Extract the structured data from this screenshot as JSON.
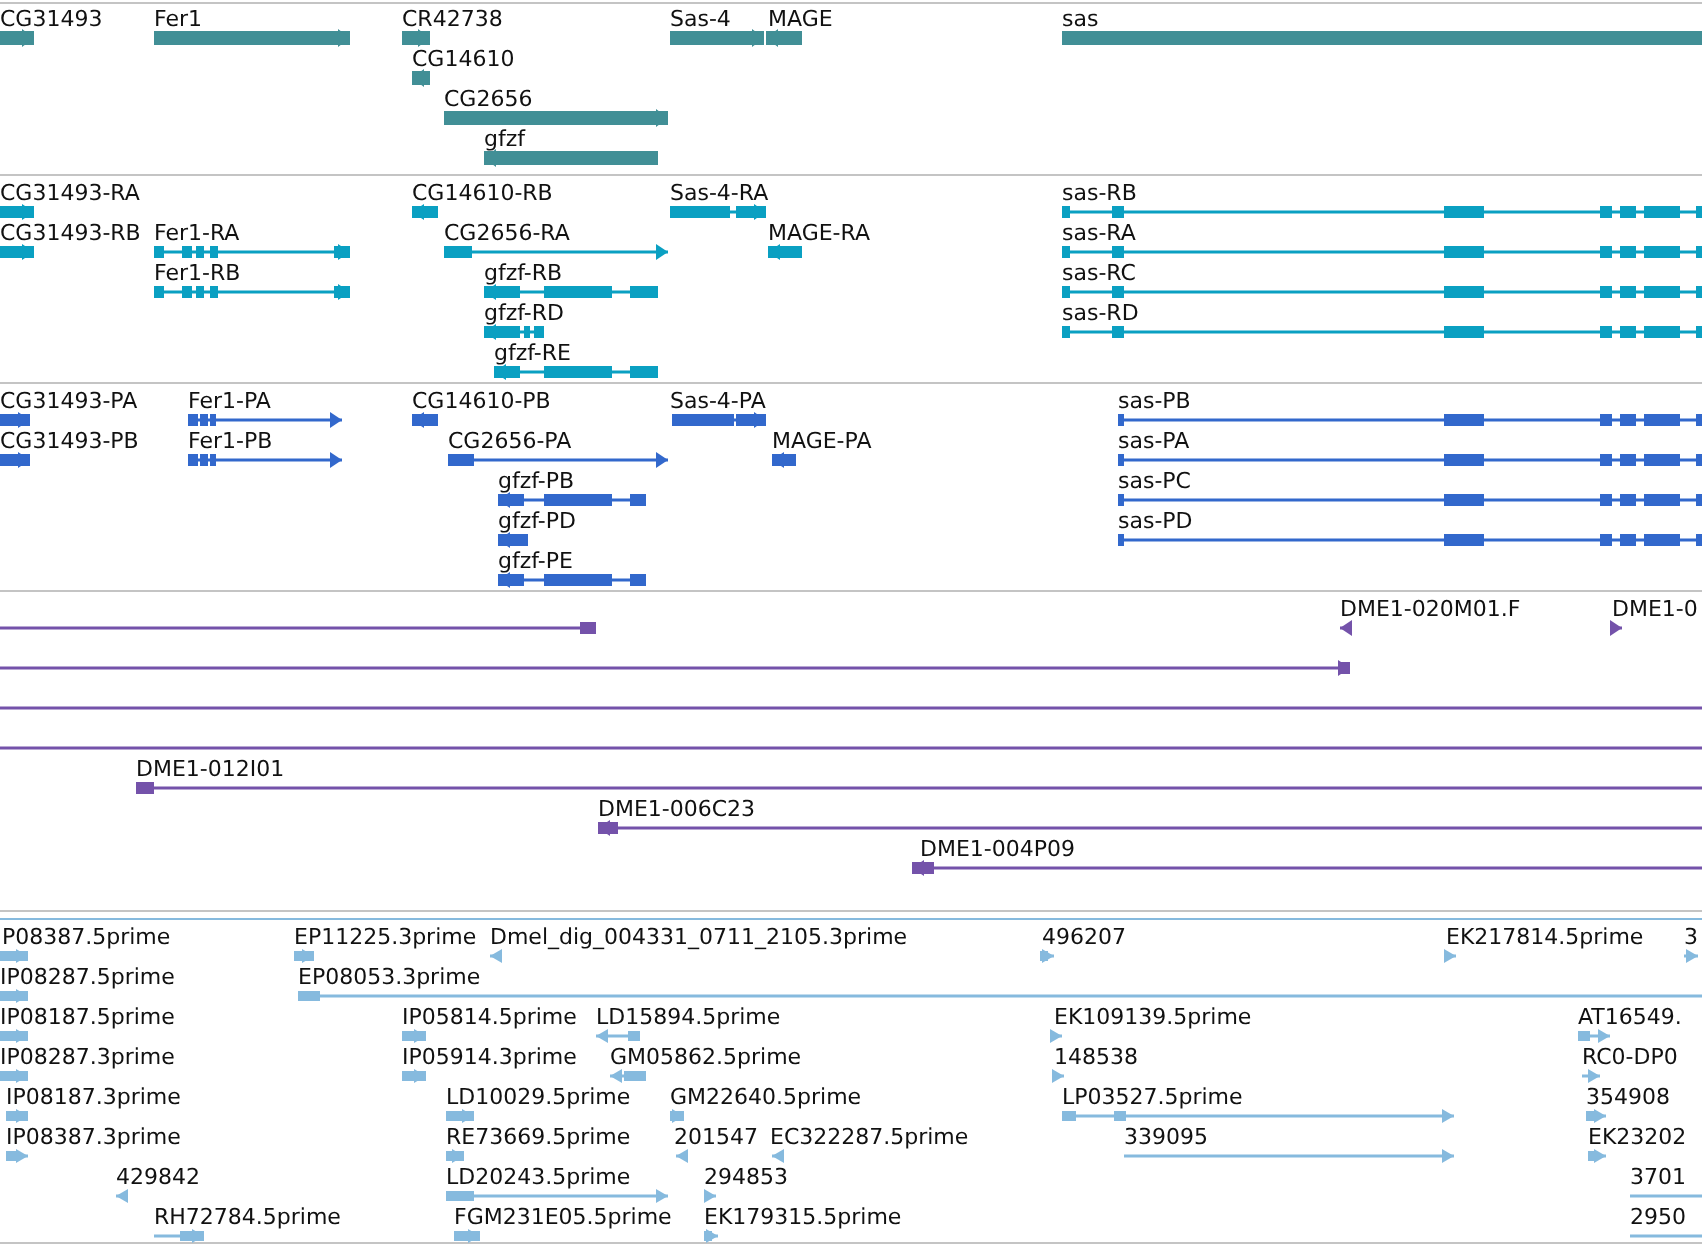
{
  "tracks": [
    {
      "kind": "gene",
      "features": [
        {
          "label": "CG31493",
          "reverse": false
        },
        {
          "label": "Fer1",
          "reverse": false
        },
        {
          "label": "CR42738",
          "reverse": false
        },
        {
          "label": "Sas-4",
          "reverse": false
        },
        {
          "label": "MAGE",
          "reverse": true
        },
        {
          "label": "sas",
          "clipped": true
        },
        {
          "label": "CG14610",
          "reverse": true
        },
        {
          "label": "CG2656",
          "reverse": false
        },
        {
          "label": "gfzf",
          "reverse": true
        }
      ]
    },
    {
      "kind": "transcript",
      "features": [
        {
          "label": "CG31493-RA",
          "reverse": false
        },
        {
          "label": "CG14610-RB",
          "reverse": true
        },
        {
          "label": "Sas-4-RA",
          "reverse": false
        },
        {
          "label": "sas-RB",
          "clipped": true
        },
        {
          "label": "CG31493-RB",
          "reverse": false
        },
        {
          "label": "Fer1-RA",
          "reverse": false
        },
        {
          "label": "CG2656-RA",
          "reverse": false
        },
        {
          "label": "MAGE-RA",
          "reverse": true
        },
        {
          "label": "sas-RA",
          "clipped": true
        },
        {
          "label": "Fer1-RB",
          "reverse": false
        },
        {
          "label": "gfzf-RB",
          "reverse": true
        },
        {
          "label": "sas-RC",
          "clipped": true
        },
        {
          "label": "gfzf-RD",
          "reverse": true
        },
        {
          "label": "sas-RD",
          "clipped": true
        },
        {
          "label": "gfzf-RE",
          "reverse": true
        }
      ]
    },
    {
      "kind": "protein",
      "features": [
        {
          "label": "CG31493-PA",
          "reverse": false
        },
        {
          "label": "Fer1-PA",
          "reverse": false
        },
        {
          "label": "CG14610-PB",
          "reverse": true
        },
        {
          "label": "Sas-4-PA",
          "reverse": false
        },
        {
          "label": "sas-PB",
          "clipped": true
        },
        {
          "label": "CG31493-PB",
          "reverse": false
        },
        {
          "label": "Fer1-PB",
          "reverse": false
        },
        {
          "label": "CG2656-PA",
          "reverse": false
        },
        {
          "label": "MAGE-PA",
          "reverse": true
        },
        {
          "label": "sas-PA",
          "clipped": true
        },
        {
          "label": "gfzf-PB",
          "reverse": true
        },
        {
          "label": "sas-PC",
          "clipped": true
        },
        {
          "label": "gfzf-PD",
          "reverse": true
        },
        {
          "label": "sas-PD",
          "clipped": true
        },
        {
          "label": "gfzf-PE",
          "reverse": true
        }
      ]
    },
    {
      "kind": "clone",
      "features": [
        {
          "clipped": true
        },
        {
          "label": "DME1-020M01.F",
          "reverse": true
        },
        {
          "label": "DME1-0",
          "reverse": false
        },
        {
          "reverse": false
        },
        {
          "clipped": true
        },
        {
          "clipped": true
        },
        {
          "label": "DME1-012I01",
          "clipped": true
        },
        {
          "label": "DME1-006C23",
          "reverse": true
        },
        {
          "label": "DME1-004P09",
          "reverse": true
        }
      ]
    },
    {
      "kind": "est",
      "features": [
        {
          "label": "P08387.5prime",
          "reverse": false
        },
        {
          "label": "EP11225.3prime",
          "reverse": false
        },
        {
          "label": "Dmel_dig_004331_0711_2105.3prime",
          "reverse": true
        },
        {
          "label": "496207",
          "reverse": false
        },
        {
          "label": "EK217814.5prime",
          "reverse": false
        },
        {
          "label": "3",
          "reverse": false
        },
        {
          "label": "IP08287.5prime",
          "reverse": false
        },
        {
          "label": "EP08053.3prime",
          "clipped": true
        },
        {
          "label": "IP08187.5prime",
          "reverse": false
        },
        {
          "label": "IP05814.5prime",
          "reverse": false
        },
        {
          "label": "LD15894.5prime",
          "reverse": true
        },
        {
          "label": "EK109139.5prime",
          "reverse": false
        },
        {
          "label": "AT16549.",
          "reverse": false
        },
        {
          "label": "IP08287.3prime",
          "reverse": false
        },
        {
          "label": "IP05914.3prime",
          "reverse": false
        },
        {
          "label": "GM05862.5prime",
          "reverse": true
        },
        {
          "label": "148538",
          "reverse": false
        },
        {
          "label": "RC0-DP0",
          "reverse": false
        },
        {
          "label": "IP08187.3prime",
          "reverse": false
        },
        {
          "label": "LD10029.5prime",
          "reverse": false
        },
        {
          "label": "GM22640.5prime",
          "reverse": false
        },
        {
          "label": "LP03527.5prime",
          "reverse": false
        },
        {
          "label": "354908",
          "reverse": false
        },
        {
          "label": "IP08387.3prime",
          "reverse": false
        },
        {
          "label": "RE73669.5prime",
          "reverse": false
        },
        {
          "label": "201547",
          "reverse": true
        },
        {
          "label": "EC322287.5prime",
          "reverse": true
        },
        {
          "label": "339095",
          "reverse": false
        },
        {
          "label": "EK23202",
          "reverse": false
        },
        {
          "label": "429842",
          "reverse": true
        },
        {
          "label": "LD20243.5prime",
          "reverse": false
        },
        {
          "label": "294853",
          "reverse": false
        },
        {
          "label": "3701",
          "clipped": true
        },
        {
          "label": "RH72784.5prime",
          "reverse": false
        },
        {
          "label": "FGM231E05.5prime",
          "reverse": false
        },
        {
          "label": "EK179315.5prime",
          "reverse": false
        },
        {
          "label": "2950",
          "clipped": true
        }
      ]
    }
  ]
}
